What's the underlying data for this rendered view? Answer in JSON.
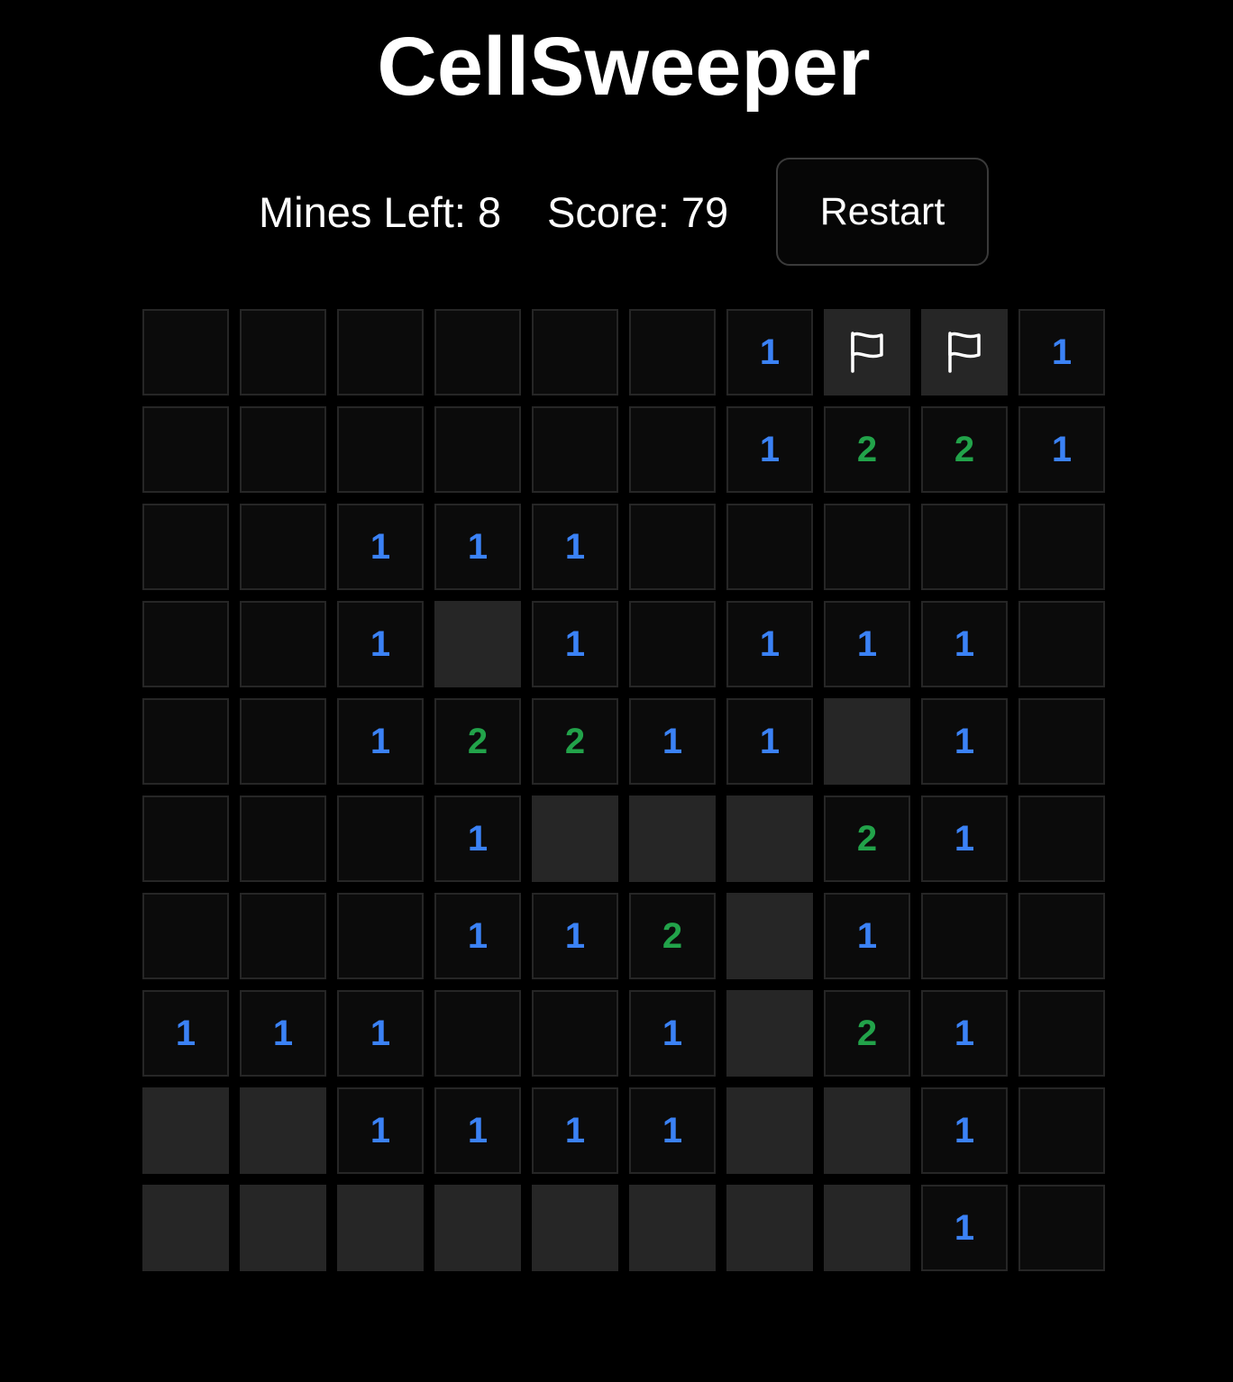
{
  "title": "CellSweeper",
  "stats": {
    "mines_left": "Mines Left: 8",
    "score": "Score: 79"
  },
  "restart_label": "Restart",
  "colors": {
    "background": "#000000",
    "revealed_cell": "#0b0b0b",
    "hidden_cell": "#262626",
    "cell_border": "#262626",
    "number_1": "#3b82f6",
    "number_2": "#22a34a",
    "flag": "#ffffff"
  },
  "board": {
    "rows": 10,
    "cols": 10,
    "legend": "Each cell: digit = revealed number, '.' = revealed empty, '#' = hidden, 'F' = flagged",
    "grid": [
      [
        ".",
        ".",
        ".",
        ".",
        ".",
        ".",
        "1",
        "F",
        "F",
        "1"
      ],
      [
        ".",
        ".",
        ".",
        ".",
        ".",
        ".",
        "1",
        "2",
        "2",
        "1"
      ],
      [
        ".",
        ".",
        "1",
        "1",
        "1",
        ".",
        ".",
        ".",
        ".",
        "."
      ],
      [
        ".",
        ".",
        "1",
        "#",
        "1",
        ".",
        "1",
        "1",
        "1",
        "."
      ],
      [
        ".",
        ".",
        "1",
        "2",
        "2",
        "1",
        "1",
        "#",
        "1",
        "."
      ],
      [
        ".",
        ".",
        ".",
        "1",
        "#",
        "#",
        "#",
        "2",
        "1",
        "."
      ],
      [
        ".",
        ".",
        ".",
        "1",
        "1",
        "2",
        "#",
        "1",
        ".",
        "."
      ],
      [
        "1",
        "1",
        "1",
        ".",
        ".",
        "1",
        "#",
        "2",
        "1",
        "."
      ],
      [
        "#",
        "#",
        "1",
        "1",
        "1",
        "1",
        "#",
        "#",
        "1",
        "."
      ],
      [
        "#",
        "#",
        "#",
        "#",
        "#",
        "#",
        "#",
        "#",
        "1",
        "."
      ]
    ]
  }
}
